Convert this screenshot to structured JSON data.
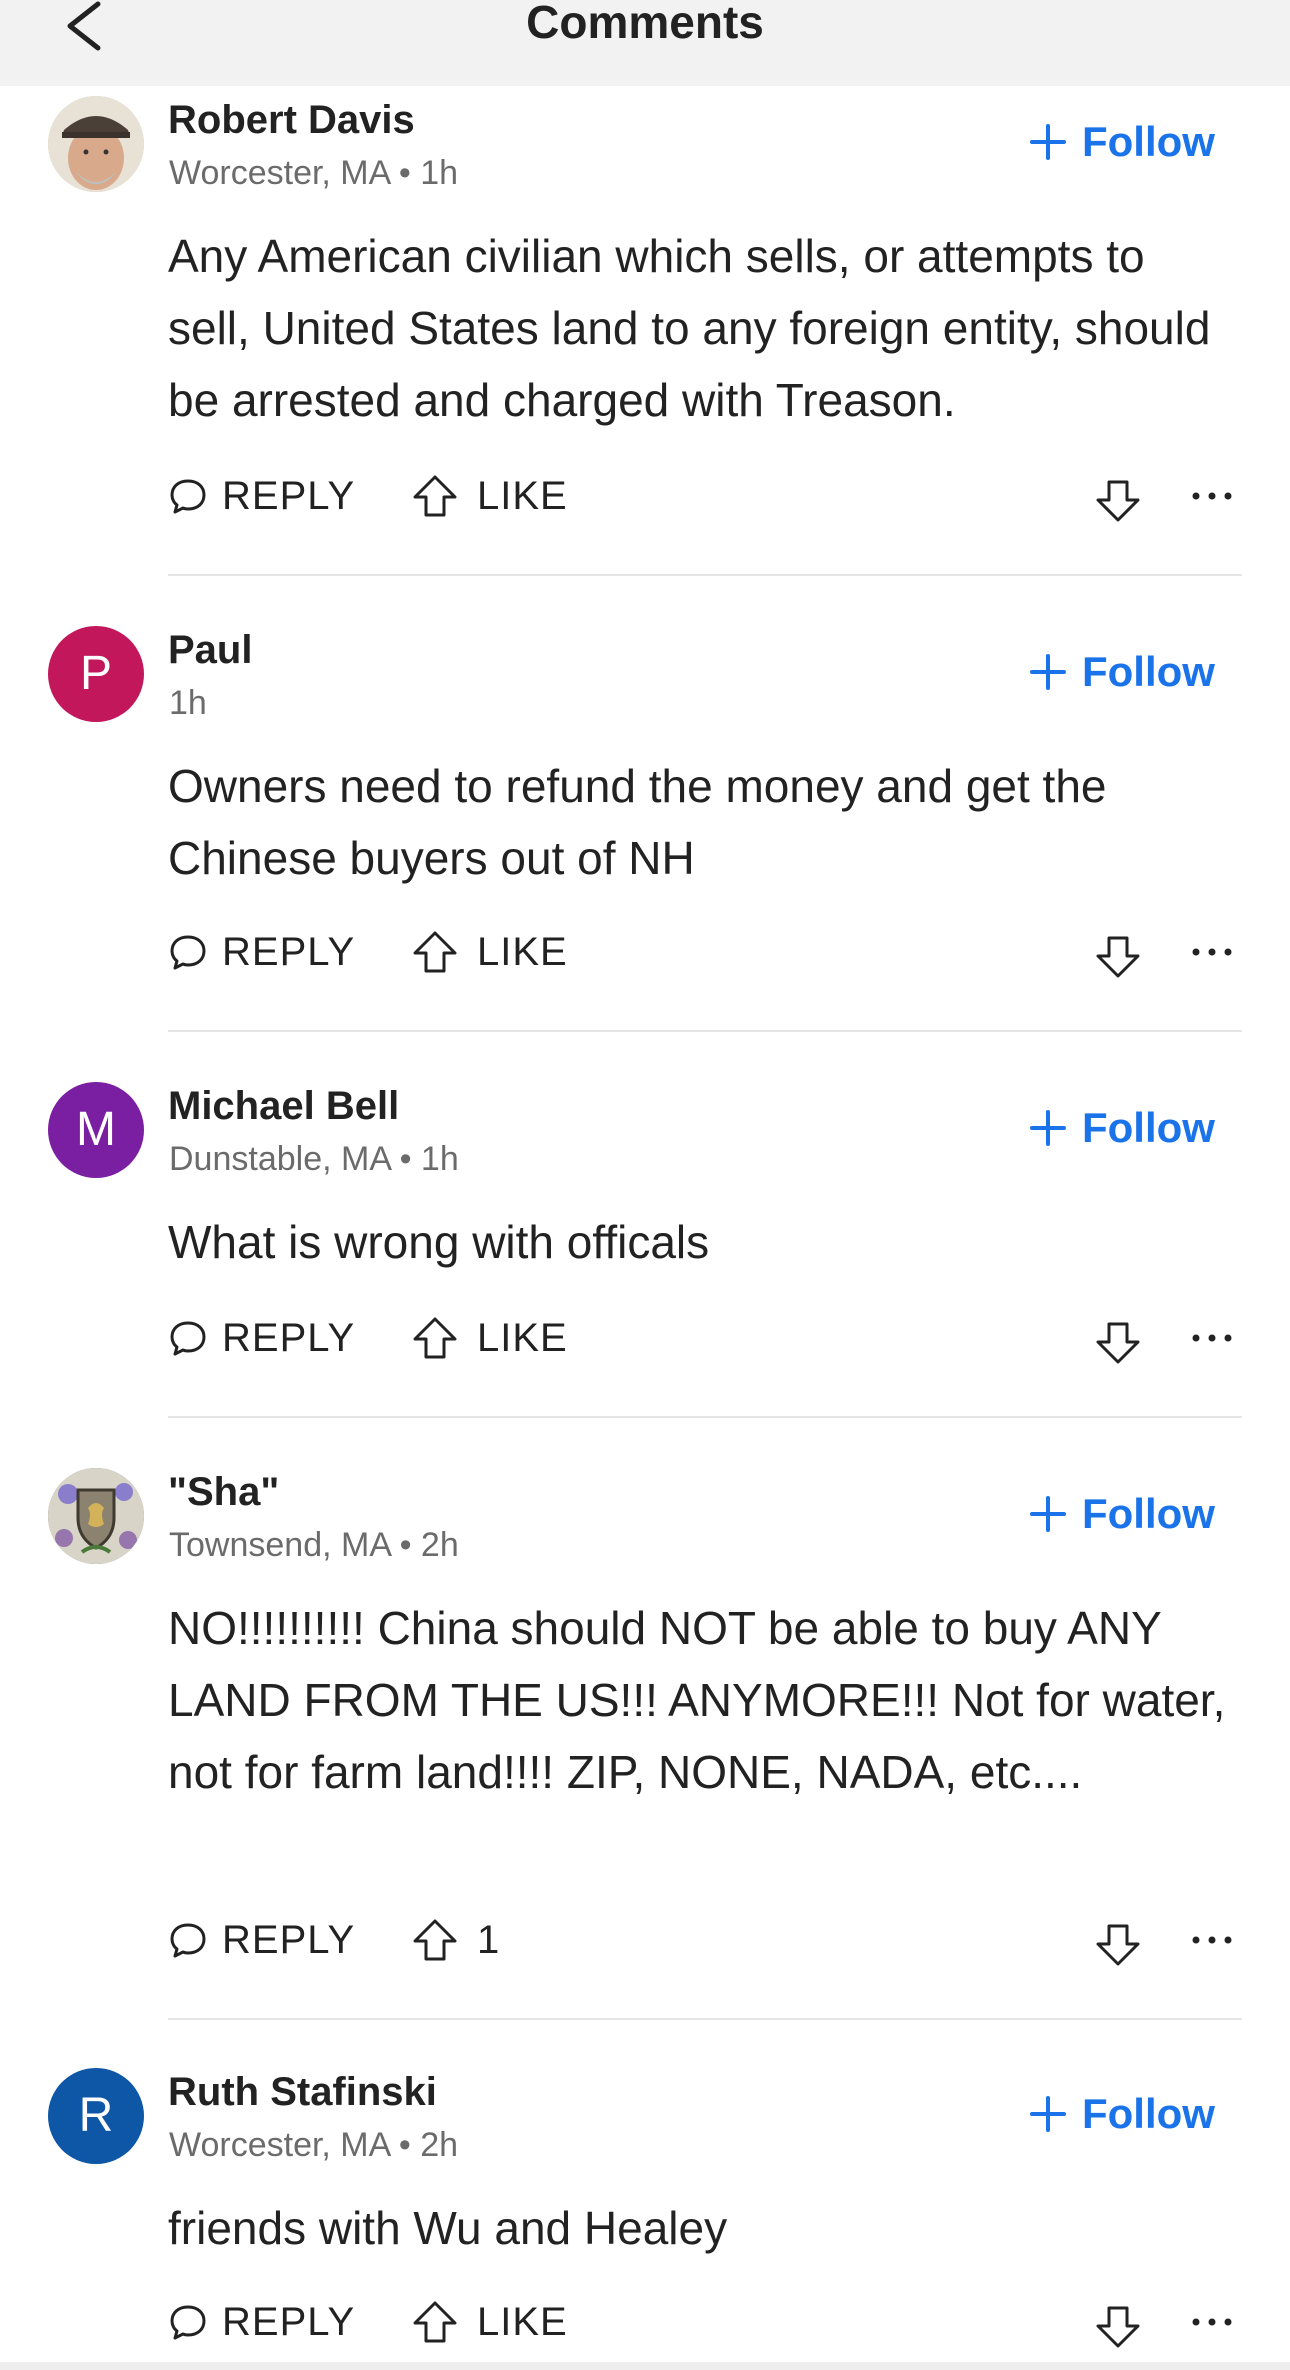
{
  "header": {
    "title": "Comments",
    "back_icon": "chevron-left-icon"
  },
  "colors": {
    "accent": "#1a73e8",
    "header_bg": "#f2f2f2",
    "text": "#222222",
    "meta": "#6b6b6b",
    "divider": "#e6e6e6"
  },
  "comments": [
    {
      "author": "Robert Davis",
      "meta": "Worcester, MA • 1h",
      "avatar": {
        "type": "photo",
        "color": "#c9b9a3"
      },
      "follow_label": "Follow",
      "text": "Any American civilian which sells, or attempts to sell, United States land to any foreign entity, should be arrested and charged with Treason.",
      "reply_label": "REPLY",
      "like_label": "LIKE"
    },
    {
      "author": "Paul",
      "meta": "1h",
      "avatar": {
        "type": "initial",
        "initial": "P",
        "color": "#c2185b"
      },
      "follow_label": "Follow",
      "text": "Owners need to refund the money and get the Chinese buyers out of NH",
      "reply_label": "REPLY",
      "like_label": "LIKE"
    },
    {
      "author": "Michael Bell",
      "meta": "Dunstable, MA • 1h",
      "avatar": {
        "type": "initial",
        "initial": "M",
        "color": "#7b1fa2"
      },
      "follow_label": "Follow",
      "text": "What is wrong with officals",
      "reply_label": "REPLY",
      "like_label": "LIKE"
    },
    {
      "author": "\"Sha\"",
      "meta": "Townsend, MA • 2h",
      "avatar": {
        "type": "emblem",
        "color": "#6d6a5e"
      },
      "follow_label": "Follow",
      "text": "NO!!!!!!!!!! China should NOT be able to buy ANY LAND FROM THE US!!! ANYMORE!!! Not for water, not for farm land!!!! ZIP, NONE, NADA, etc....",
      "reply_label": "REPLY",
      "like_label": "1"
    },
    {
      "author": "Ruth Stafinski",
      "meta": "Worcester, MA • 2h",
      "avatar": {
        "type": "initial",
        "initial": "R",
        "color": "#0d57a6"
      },
      "follow_label": "Follow",
      "text": "friends with Wu and Healey",
      "reply_label": "REPLY",
      "like_label": "LIKE"
    }
  ]
}
